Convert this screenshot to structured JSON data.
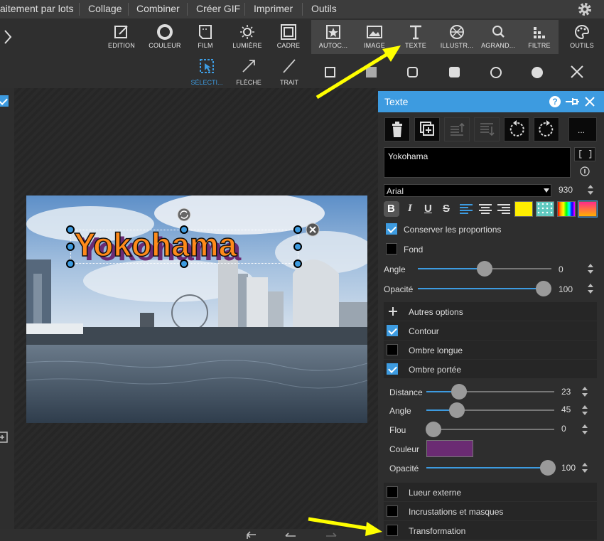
{
  "menubar": {
    "items": [
      "aitement par lots",
      "Collage",
      "Combiner",
      "Créer GIF",
      "Imprimer",
      "Outils"
    ]
  },
  "toolbar": {
    "left": [
      {
        "label": "EDITION",
        "icon": "edit-icon"
      },
      {
        "label": "COULEUR",
        "icon": "circle-icon"
      },
      {
        "label": "FILM",
        "icon": "film-icon"
      },
      {
        "label": "LUMIÈRE",
        "icon": "sun-icon"
      },
      {
        "label": "CADRE",
        "icon": "frame-icon"
      }
    ],
    "right": [
      {
        "label": "AUTOC...",
        "icon": "sticker-icon"
      },
      {
        "label": "IMAGE",
        "icon": "image-icon"
      },
      {
        "label": "TEXTE",
        "icon": "text-icon"
      },
      {
        "label": "ILLUSTR...",
        "icon": "aperture-icon"
      },
      {
        "label": "AGRAND...",
        "icon": "magnify-icon"
      },
      {
        "label": "FILTRE",
        "icon": "filter-icon"
      }
    ],
    "tools_label": "OUTILS"
  },
  "subtoolbar": {
    "tools": [
      {
        "label": "SÉLECTI...",
        "icon": "select-icon"
      },
      {
        "label": "FLÈCHE",
        "icon": "arrow-icon"
      },
      {
        "label": "TRAIT",
        "icon": "line-icon"
      }
    ]
  },
  "canvas": {
    "text_overlay": "Yokohama"
  },
  "panel": {
    "title": "Texte",
    "more_label": "...",
    "text_value": "Yokohama",
    "bracket_label": "[ ]",
    "font_name": "Arial",
    "font_size": "930",
    "keep_ratio_label": "Conserver les proportions",
    "background_label": "Fond",
    "angle_label": "Angle",
    "angle_value": "0",
    "opacity_label": "Opacité",
    "opacity_value": "100",
    "more_options_label": "Autres options",
    "contour_label": "Contour",
    "long_shadow_label": "Ombre longue",
    "drop_shadow_label": "Ombre portée",
    "shadow": {
      "distance_label": "Distance",
      "distance_value": "23",
      "angle_label": "Angle",
      "angle_value": "45",
      "blur_label": "Flou",
      "blur_value": "0",
      "color_label": "Couleur",
      "color_hex": "#6b2b73",
      "opacity_label": "Opacité",
      "opacity_value": "100"
    },
    "glow_label": "Lueur externe",
    "inlay_label": "Incrustations et masques",
    "transform_label": "Transformation",
    "accent_color": "#3d9be0",
    "swatch_yellow": "#ffee00"
  },
  "annotation_color": "#ffff00"
}
